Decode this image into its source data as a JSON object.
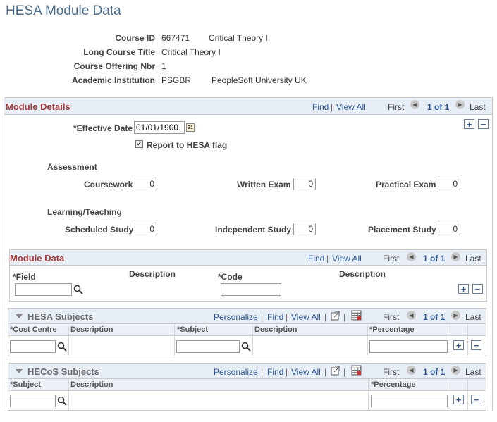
{
  "page": {
    "title": "HESA Module Data"
  },
  "header": {
    "course_id_label": "Course ID",
    "course_id": "667471",
    "course_name": "Critical Theory I",
    "long_title_label": "Long Course Title",
    "long_title": "Critical Theory I",
    "offering_label": "Course Offering Nbr",
    "offering": "1",
    "institution_label": "Academic Institution",
    "institution_code": "PSGBR",
    "institution_name": "PeopleSoft University UK"
  },
  "module_details": {
    "title": "Module Details",
    "nav": {
      "find": "Find",
      "view_all": "View All",
      "first": "First",
      "count": "1 of 1",
      "last": "Last"
    },
    "effective_date_label": "*Effective Date",
    "effective_date": "01/01/1900",
    "report_flag_label": "Report to HESA flag",
    "report_flag_checked": true,
    "assessment_label": "Assessment",
    "coursework_label": "Coursework",
    "coursework": "0",
    "written_exam_label": "Written Exam",
    "written_exam": "0",
    "practical_exam_label": "Practical Exam",
    "practical_exam": "0",
    "learning_label": "Learning/Teaching",
    "scheduled_label": "Scheduled Study",
    "scheduled": "0",
    "independent_label": "Independent Study",
    "independent": "0",
    "placement_label": "Placement Study",
    "placement": "0"
  },
  "module_data": {
    "title": "Module Data",
    "nav": {
      "find": "Find",
      "view_all": "View All",
      "first": "First",
      "count": "1 of 1",
      "last": "Last"
    },
    "field_label": "*Field",
    "description1": "Description",
    "code_label": "*Code",
    "description2": "Description"
  },
  "hesa_subjects": {
    "title": "HESA Subjects",
    "nav": {
      "personalize": "Personalize",
      "find": "Find",
      "view_all": "View All",
      "first": "First",
      "count": "1 of 1",
      "last": "Last"
    },
    "columns": [
      "*Cost Centre",
      "Description",
      "*Subject",
      "Description",
      "*Percentage"
    ]
  },
  "hecos_subjects": {
    "title": "HECoS Subjects",
    "nav": {
      "personalize": "Personalize",
      "find": "Find",
      "view_all": "View All",
      "first": "First",
      "count": "1 of 1",
      "last": "Last"
    },
    "columns": [
      "*Subject",
      "Description",
      "*Percentage"
    ]
  },
  "icons": [
    "first-icon",
    "last-icon",
    "add-row-icon",
    "delete-row-icon",
    "lookup-icon",
    "calendar-icon",
    "zoom-icon",
    "download-icon",
    "collapse-icon"
  ]
}
